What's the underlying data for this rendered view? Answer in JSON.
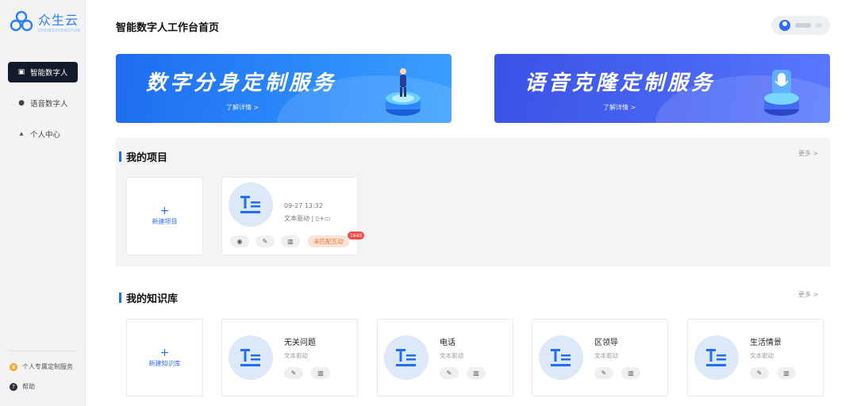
{
  "brand": {
    "name": "众生云",
    "subtitle": "ZHONGSHENGYUN"
  },
  "nav": [
    {
      "label": "智能数字人",
      "icon": "robot-icon",
      "active": true
    },
    {
      "label": "语音数字人",
      "icon": "microphone-icon",
      "active": false
    },
    {
      "label": "个人中心",
      "icon": "user-icon",
      "active": false
    }
  ],
  "side_bottom": [
    {
      "label": "个人专属定制服务",
      "icon": "crown-icon"
    },
    {
      "label": "帮助",
      "icon": "help-icon"
    }
  ],
  "header": {
    "title": "智能数字人工作台首页"
  },
  "banners": [
    {
      "title": "数字分身定制服务",
      "link": "了解详情 >"
    },
    {
      "title": "语音克隆定制服务",
      "link": "了解详情 >"
    }
  ],
  "projects": {
    "title": "我的项目",
    "more": "更多 >",
    "new_label": "新建项目",
    "items": [
      {
        "time": "09-27 13:32",
        "drive": "文本驱动  |  ▯+▭",
        "tag": "未匹配互动",
        "count": "1640"
      }
    ]
  },
  "knowledge": {
    "title": "我的知识库",
    "more": "更多 >",
    "new_label": "新建知识库",
    "items": [
      {
        "name": "无关问题",
        "sub": "文本驱动"
      },
      {
        "name": "电话",
        "sub": "文本驱动"
      },
      {
        "name": "区领导",
        "sub": "文本驱动"
      },
      {
        "name": "生活情景",
        "sub": "文本驱动"
      }
    ]
  },
  "colors": {
    "accent": "#1f6ef5",
    "sidebar_active": "#141a2b",
    "tag_bg": "#fde3d3",
    "badge": "#f04848"
  }
}
